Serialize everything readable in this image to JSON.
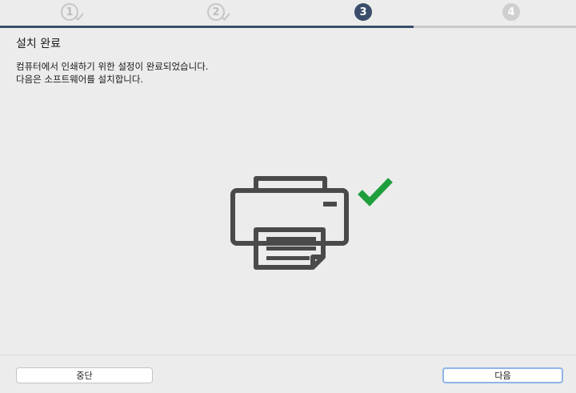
{
  "steps": [
    {
      "label": "1",
      "state": "done"
    },
    {
      "label": "2",
      "state": "done"
    },
    {
      "label": "3",
      "state": "current"
    },
    {
      "label": "4",
      "state": "todo"
    }
  ],
  "progress": {
    "completed_steps": 3,
    "total_steps": 4
  },
  "page": {
    "title": "설치 완료",
    "line1": "컴퓨터에서 인쇄하기 위한 설정이 완료되었습니다.",
    "line2": "다음은 소프트웨어를 설치합니다."
  },
  "illustration": {
    "printer_icon": "printer-icon",
    "check_icon": "checkmark-icon",
    "printer_color": "#4a4a4a",
    "check_color": "#1f9e3d"
  },
  "buttons": {
    "cancel_label": "중단",
    "next_label": "다음"
  },
  "colors": {
    "accent": "#3a4d6b",
    "focus_ring": "#8fb4e6"
  }
}
